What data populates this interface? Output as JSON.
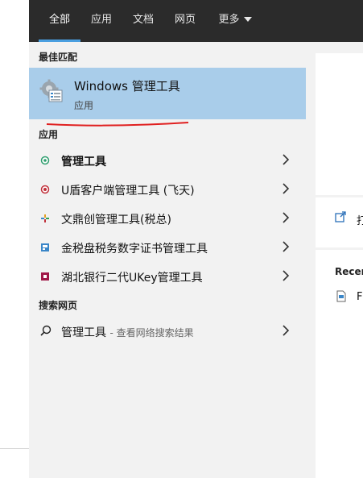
{
  "tabs": [
    {
      "label": "全部",
      "active": true
    },
    {
      "label": "应用",
      "active": false
    },
    {
      "label": "文档",
      "active": false
    },
    {
      "label": "网页",
      "active": false
    },
    {
      "label": "更多",
      "active": false
    }
  ],
  "sections": {
    "best_match": "最佳匹配",
    "apps": "应用",
    "web": "搜索网页"
  },
  "best_match": {
    "title": "Windows 管理工具",
    "subtitle": "应用",
    "icon": "gear-icon"
  },
  "apps": [
    {
      "label": "管理工具",
      "bold": true,
      "icon": "green-circle-icon"
    },
    {
      "label": "U盾客户端管理工具 (飞天)",
      "bold": false,
      "icon": "red-circle-icon"
    },
    {
      "label": "文鼎创管理工具(税总)",
      "bold": false,
      "icon": "colored-star-icon"
    },
    {
      "label": "金税盘税务数字证书管理工具",
      "bold": false,
      "icon": "blue-square-icon"
    },
    {
      "label": "湖北银行二代UKey管理工具",
      "bold": false,
      "icon": "maroon-square-icon"
    }
  ],
  "web_search": {
    "query": "管理工具",
    "hint": "- 查看网络搜索结果",
    "icon": "search-icon"
  },
  "preview": {
    "open_label": "打",
    "recent_label": "Recen",
    "file_label": "F"
  },
  "colors": {
    "tabbar_bg": "#2b2b2b",
    "accent": "#4a9fe0",
    "selected_bg": "#a9cdea",
    "panel_bg": "#f2f2f2",
    "annotation_red": "#e02020"
  }
}
